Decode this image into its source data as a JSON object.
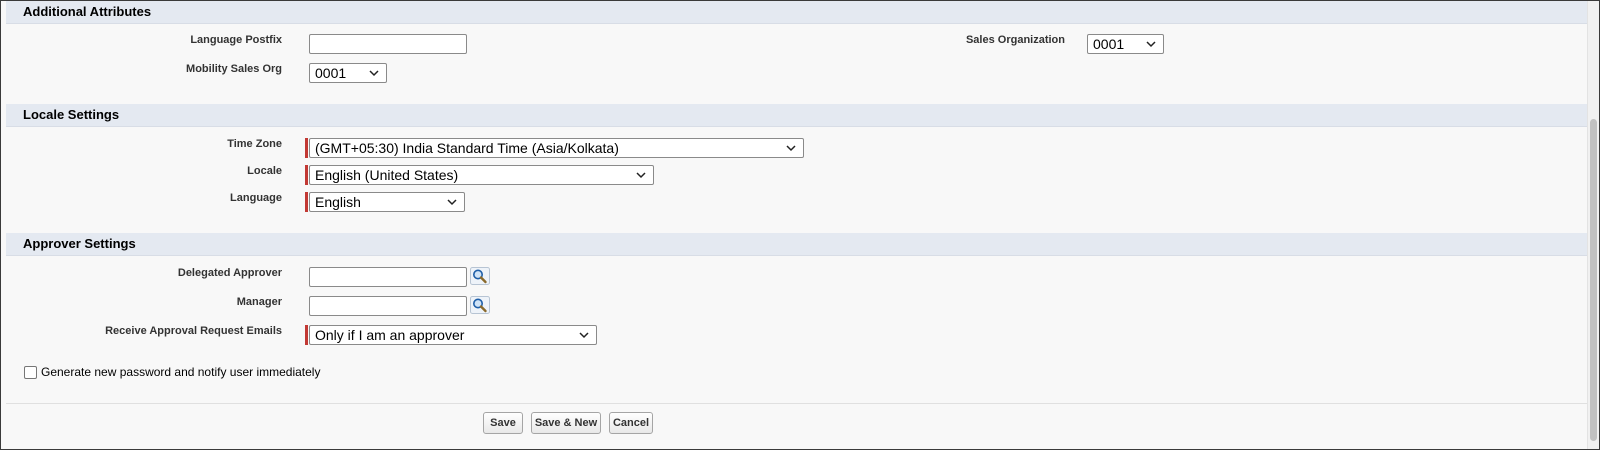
{
  "additional_attributes": {
    "title": "Additional Attributes",
    "language_postfix": {
      "label": "Language Postfix",
      "value": ""
    },
    "mobility_sales_org": {
      "label": "Mobility Sales Org",
      "value": "0001"
    },
    "sales_organization": {
      "label": "Sales Organization",
      "value": "0001"
    }
  },
  "locale_settings": {
    "title": "Locale Settings",
    "time_zone": {
      "label": "Time Zone",
      "value": "(GMT+05:30) India Standard Time (Asia/Kolkata)"
    },
    "locale": {
      "label": "Locale",
      "value": "English (United States)"
    },
    "language": {
      "label": "Language",
      "value": "English"
    }
  },
  "approver_settings": {
    "title": "Approver Settings",
    "delegated_approver": {
      "label": "Delegated Approver",
      "value": ""
    },
    "manager": {
      "label": "Manager",
      "value": ""
    },
    "receive_emails": {
      "label": "Receive Approval Request Emails",
      "value": "Only if I am an approver"
    }
  },
  "generate_password": {
    "label": "Generate new password and notify user immediately",
    "checked": false
  },
  "buttons": {
    "save": "Save",
    "save_new": "Save & New",
    "cancel": "Cancel"
  },
  "colors": {
    "section_header_bg": "#e4e9f1",
    "required_marker": "#c23934",
    "page_bg": "#f8f8f8"
  },
  "icons": {
    "lookup": "lookup-magnifier-icon",
    "dropdown": "chevron-down-icon"
  }
}
